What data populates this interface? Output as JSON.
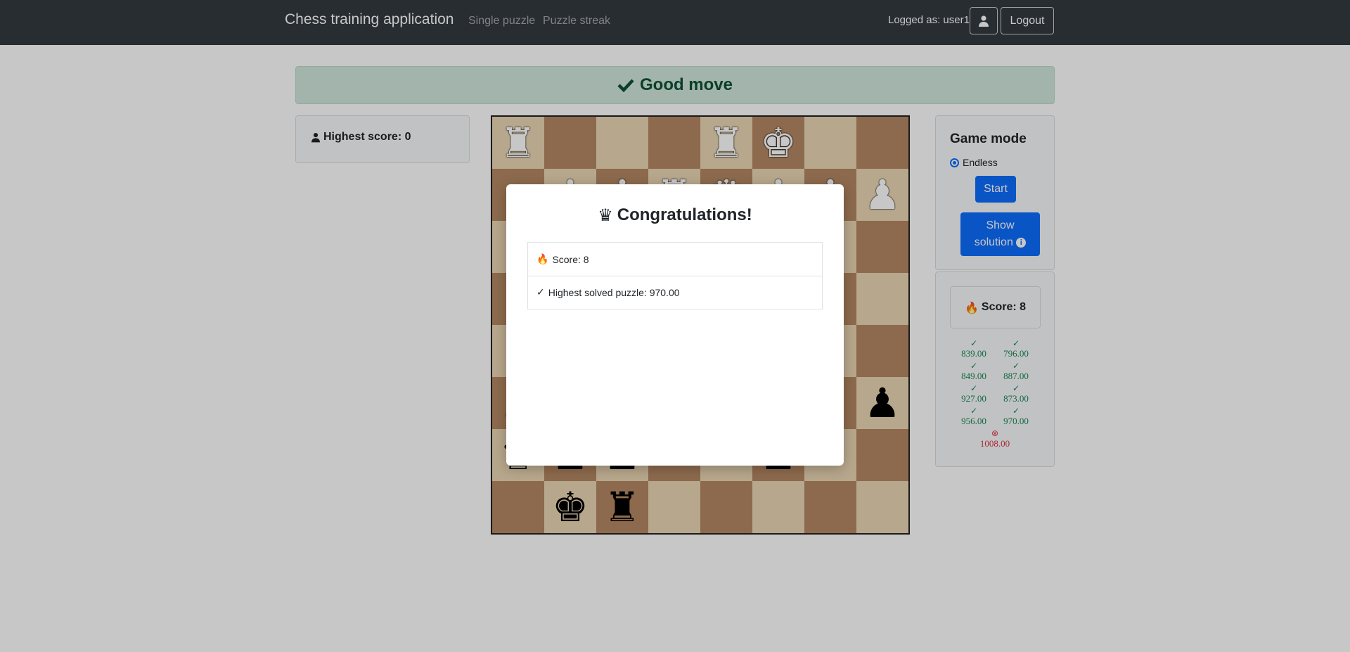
{
  "navbar": {
    "brand": "Chess training application",
    "links": [
      "Single puzzle",
      "Puzzle streak"
    ],
    "logged_as": "Logged as: user1",
    "logout_label": "Logout"
  },
  "alert": {
    "message": "Good move",
    "icon": "check-icon",
    "color": "#0f5132"
  },
  "highscore": {
    "label": "Highest score: 0",
    "icon": "user-icon"
  },
  "board": {
    "ranks": [
      [
        "♜",
        "",
        "",
        "",
        "♜",
        "♚",
        "",
        ""
      ],
      [
        "",
        "♟",
        "♟",
        "♜",
        "♛",
        "♟",
        "♟",
        "♟"
      ],
      [
        "",
        "",
        "",
        "",
        "",
        "",
        "",
        ""
      ],
      [
        "",
        "",
        "",
        "",
        "",
        "",
        "",
        ""
      ],
      [
        "",
        "",
        "",
        "",
        "",
        "",
        "",
        ""
      ],
      [
        "♟",
        "",
        "",
        "",
        "",
        "",
        "",
        "♟"
      ],
      [
        "♛",
        "♟",
        "♟",
        "",
        "",
        "♟",
        "",
        ""
      ],
      [
        "",
        "♚",
        "♜",
        "",
        "",
        "",
        "",
        ""
      ]
    ],
    "white_rows": [
      0,
      1
    ]
  },
  "game_mode": {
    "title": "Game mode",
    "option": "Endless",
    "start_label": "Start",
    "solution_line1": "Show",
    "solution_line2": "solution"
  },
  "score_panel": {
    "score_label": "Score: 8",
    "results": [
      {
        "value": "839.00",
        "status": "ok"
      },
      {
        "value": "796.00",
        "status": "ok"
      },
      {
        "value": "849.00",
        "status": "ok"
      },
      {
        "value": "887.00",
        "status": "ok"
      },
      {
        "value": "927.00",
        "status": "ok"
      },
      {
        "value": "873.00",
        "status": "ok"
      },
      {
        "value": "956.00",
        "status": "ok"
      },
      {
        "value": "970.00",
        "status": "ok"
      },
      {
        "value": "1008.00",
        "status": "fail"
      }
    ]
  },
  "modal": {
    "title": "Congratulations!",
    "score": "Score: 8",
    "highest": "Highest solved puzzle: 970.00"
  }
}
